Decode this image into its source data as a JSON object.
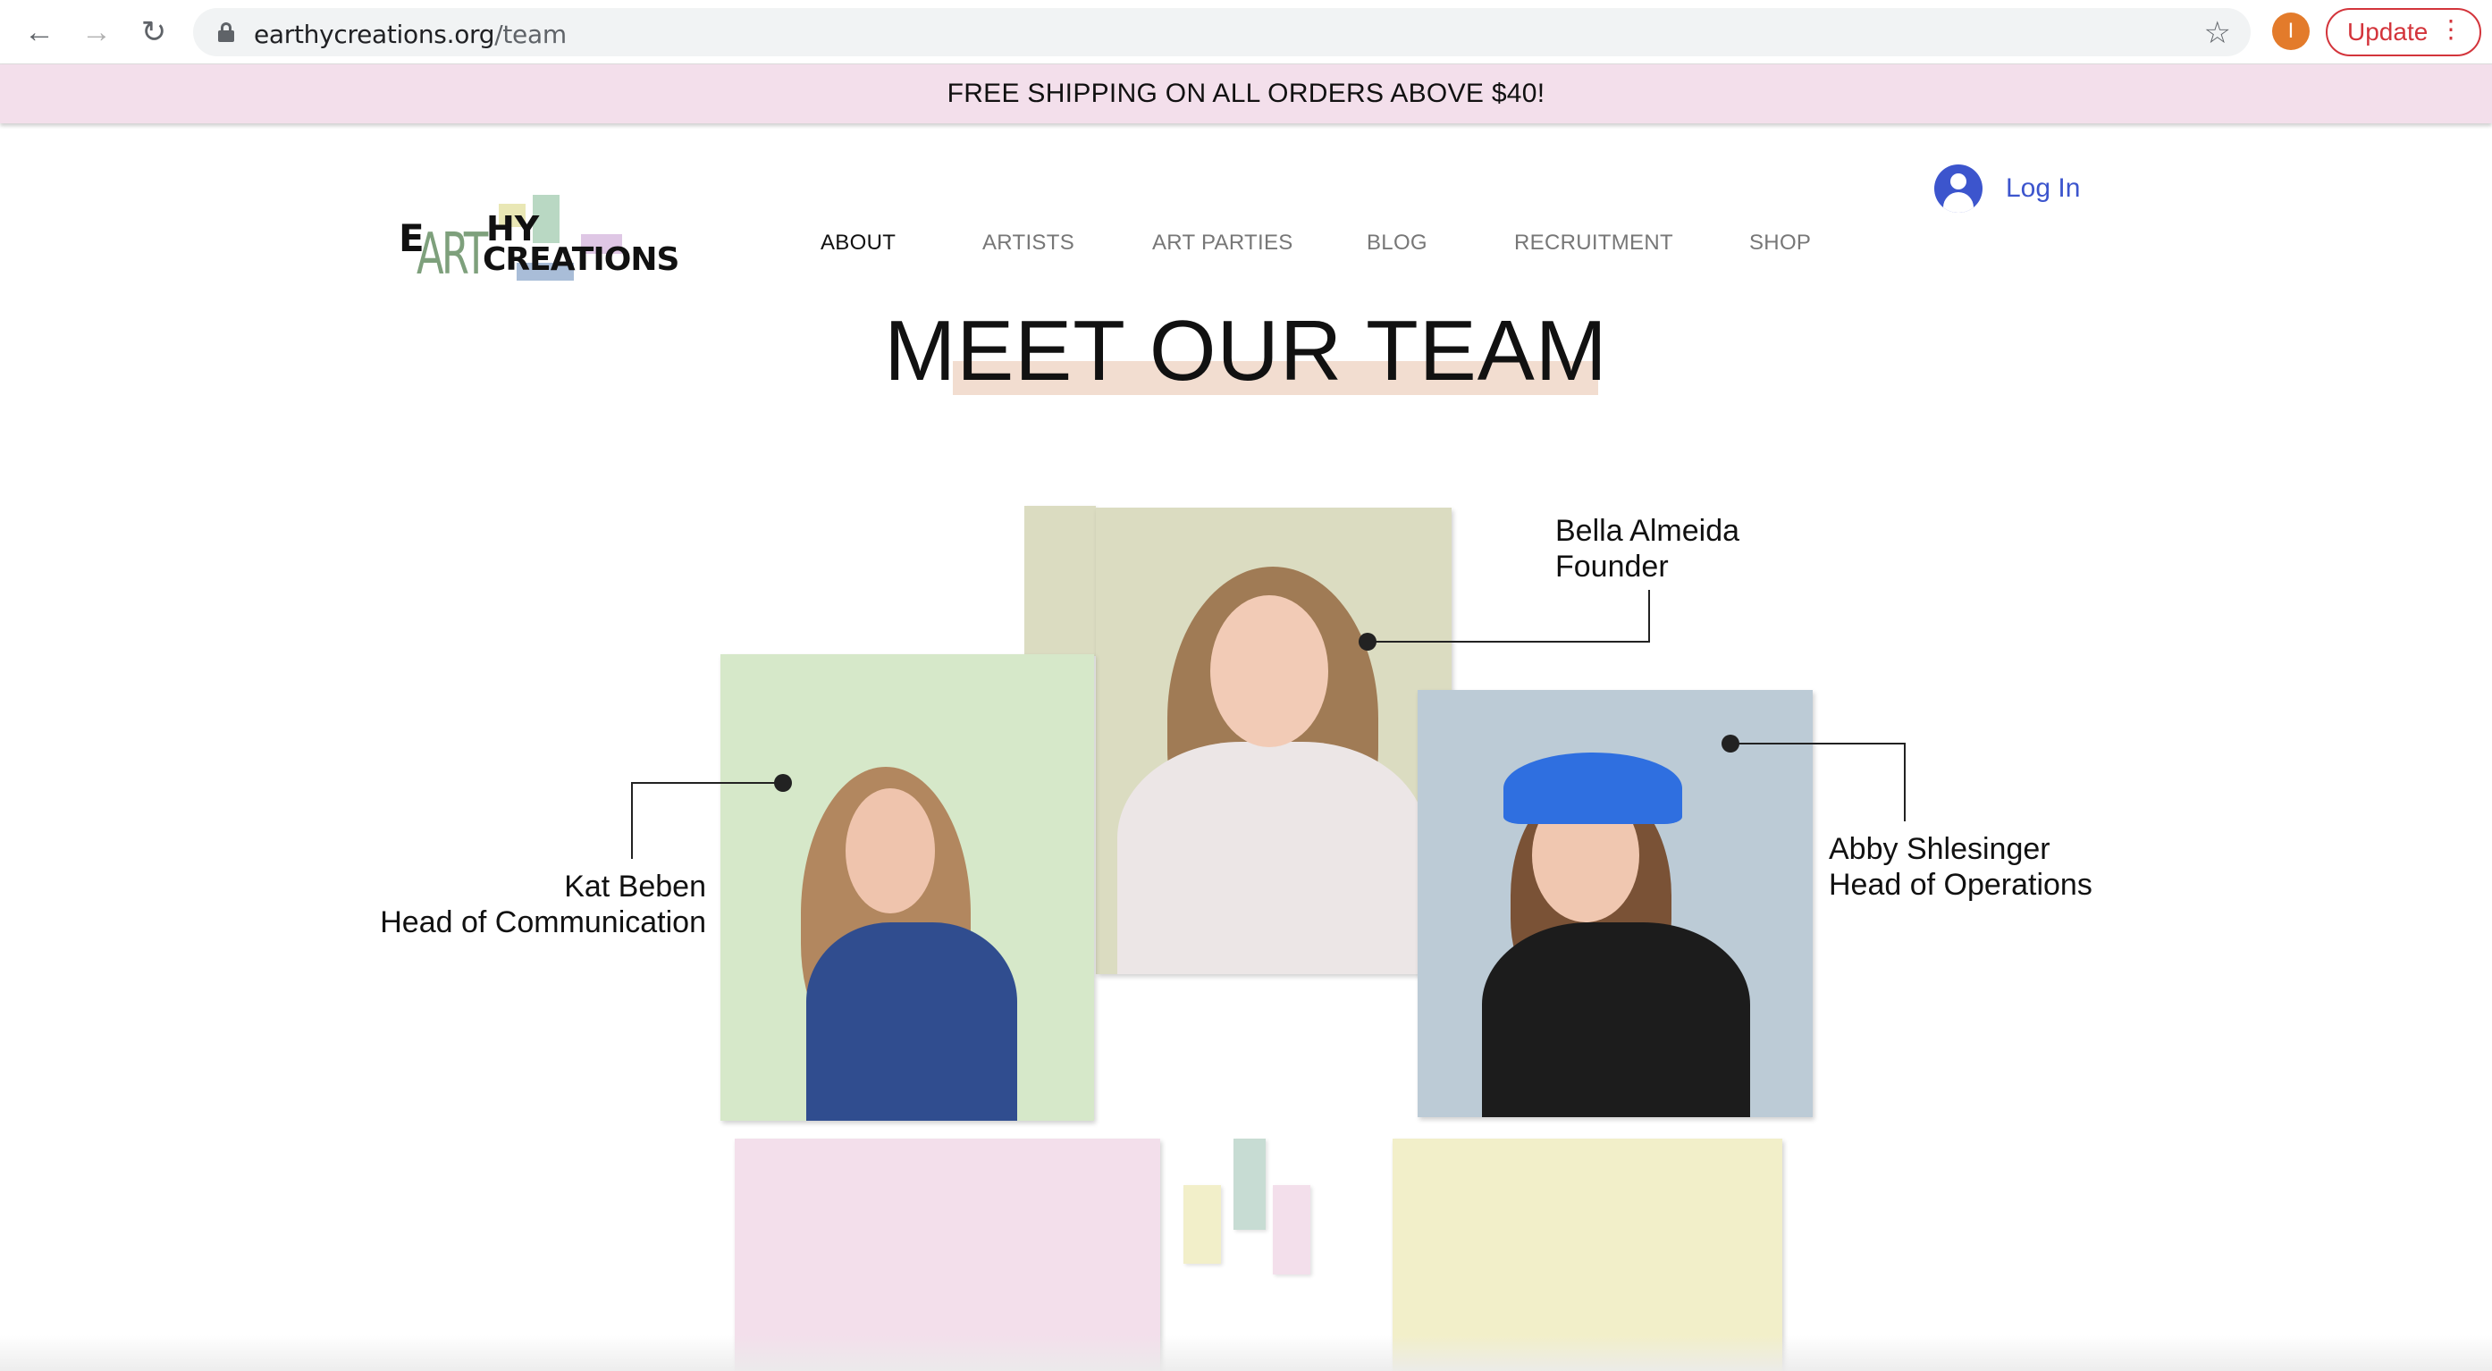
{
  "browser": {
    "url_host": "earthycreations.org",
    "url_path": "/team",
    "profile_initial": "I",
    "update_label": "Update",
    "icons": [
      "back-arrow-icon",
      "forward-arrow-icon",
      "reload-icon",
      "lock-icon",
      "star-icon",
      "menu-dots-icon"
    ]
  },
  "banner": {
    "text": "FREE SHIPPING ON ALL ORDERS ABOVE $40!"
  },
  "logo": {
    "line1_e": "E",
    "line1_art": "ART",
    "line1_hy": "HY",
    "line2": "CREATIONS"
  },
  "nav": {
    "items": [
      {
        "label": "ABOUT",
        "active": true
      },
      {
        "label": "ARTISTS",
        "active": false
      },
      {
        "label": "ART PARTIES",
        "active": false
      },
      {
        "label": "BLOG",
        "active": false
      },
      {
        "label": "RECRUITMENT",
        "active": false
      },
      {
        "label": "SHOP",
        "active": false
      }
    ],
    "login_label": "Log In"
  },
  "page": {
    "title": "MEET OUR TEAM"
  },
  "team": [
    {
      "name": "Bella Almeida",
      "role": "Founder"
    },
    {
      "name": "Kat Beben",
      "role": "Head of Communication"
    },
    {
      "name": "Abby Shlesinger",
      "role": "Head of Operations"
    }
  ],
  "colors": {
    "banner_bg": "#f3dfeb",
    "login_blue": "#3c55cd",
    "update_red": "#d3343b",
    "title_highlight": "#f2ddd0",
    "card_green": "#d6e8c9",
    "card_khaki": "#dbdcc1",
    "card_blue": "#bccbd6",
    "card_pink": "#f3dfeb",
    "card_yellow": "#f2efc9"
  }
}
